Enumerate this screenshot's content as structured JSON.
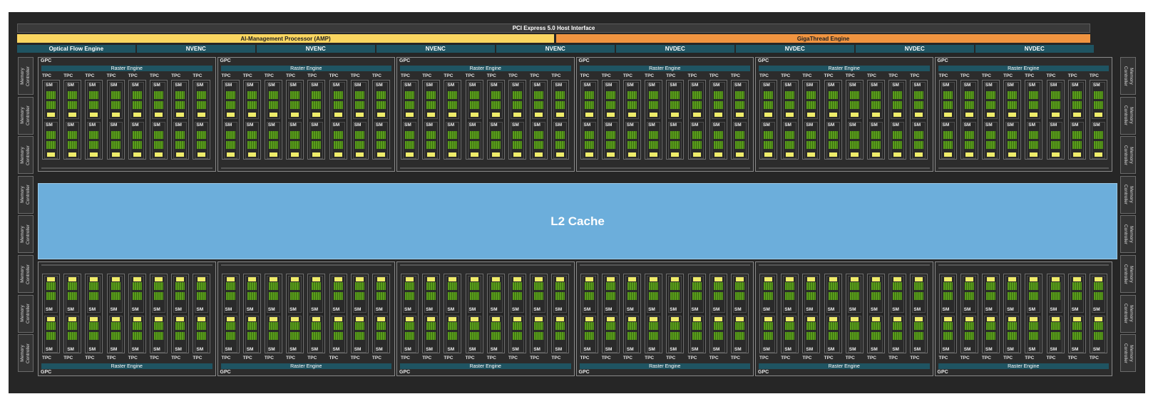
{
  "header": {
    "pcie": "PCI Express 5.0 Host Interface",
    "amp": "AI-Management Processor (AMP)",
    "gigathread": "GigaThread Engine"
  },
  "engines": [
    "Optical Flow Engine",
    "NVENC",
    "NVENC",
    "NVENC",
    "NVENC",
    "NVDEC",
    "NVDEC",
    "NVDEC",
    "NVDEC"
  ],
  "memory_controller_label": "Memory\nController",
  "l2_cache": "L2 Cache",
  "gpc": {
    "label": "GPC",
    "raster_engine": "Raster Engine",
    "tpc_label": "TPC",
    "sm_label": "SM"
  },
  "colors": {
    "amp": "#fbd660",
    "gigathread": "#f09440",
    "engine": "#1f5462",
    "l2": "#6caedb",
    "cuda_cores": "#5a9c1c",
    "tensor_cores": "#efec6a"
  }
}
